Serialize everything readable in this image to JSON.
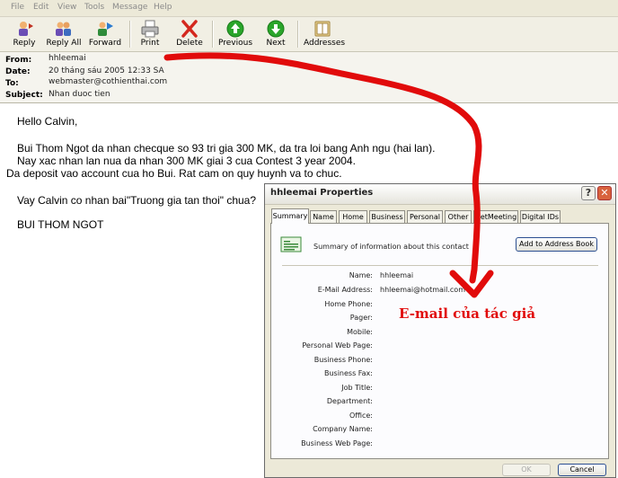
{
  "menu": [
    "File",
    "Edit",
    "View",
    "Tools",
    "Message",
    "Help"
  ],
  "toolbar": {
    "reply": "Reply",
    "reply_all": "Reply All",
    "forward": "Forward",
    "print": "Print",
    "delete": "Delete",
    "previous": "Previous",
    "next": "Next",
    "addresses": "Addresses"
  },
  "header": {
    "from_label": "From:",
    "from": "hhleemai",
    "date_label": "Date:",
    "date": "20 tháng sáu 2005 12:33 SA",
    "to_label": "To:",
    "to": "webmaster@cothienthai.com",
    "subject_label": "Subject:",
    "subject": "Nhan duoc tien"
  },
  "body": {
    "greeting": "Hello Calvin,",
    "line1": "Bui Thom Ngot da nhan checque so 93 tri gia 300 MK, da tra loi bang Anh ngu (hai lan).",
    "line2": "Nay xac nhan lan nua da nhan 300 MK giai 3 cua Contest 3 year 2004.",
    "line3": "Da deposit vao account cua ho Bui. Rat cam on quy huynh va to chuc.",
    "line4": "Vay Calvin co nhan bai\"Truong gia tan thoi\" chua?",
    "signature": "BUI THOM NGOT"
  },
  "dialog": {
    "title": "hhleemai Properties",
    "help": "?",
    "close": "✕",
    "tabs": [
      "Summary",
      "Name",
      "Home",
      "Business",
      "Personal",
      "Other",
      "NetMeeting",
      "Digital IDs"
    ],
    "active_tab": "Summary",
    "summary_text": "Summary of information about this contact",
    "add_button": "Add to Address Book",
    "fields": [
      {
        "label": "Name:",
        "value": "hhleemai"
      },
      {
        "label": "E-Mail Address:",
        "value": "hhleemai@hotmail.com"
      },
      {
        "label": "Home Phone:",
        "value": ""
      },
      {
        "label": "Pager:",
        "value": ""
      },
      {
        "label": "Mobile:",
        "value": ""
      },
      {
        "label": "Personal Web Page:",
        "value": ""
      },
      {
        "label": "Business Phone:",
        "value": ""
      },
      {
        "label": "Business Fax:",
        "value": ""
      },
      {
        "label": "Job Title:",
        "value": ""
      },
      {
        "label": "Department:",
        "value": ""
      },
      {
        "label": "Office:",
        "value": ""
      },
      {
        "label": "Company Name:",
        "value": ""
      },
      {
        "label": "Business Web Page:",
        "value": ""
      }
    ],
    "ok": "OK",
    "cancel": "Cancel"
  },
  "annotation": "E-mail của tác giả",
  "colors": {
    "annotation_red": "#e10b0b",
    "chrome": "#ece9d8",
    "toolbar_green": "#2aa52a",
    "delete_red": "#d4281e"
  },
  "icons": [
    "reply-icon",
    "reply-all-icon",
    "forward-icon",
    "print-icon",
    "delete-icon",
    "previous-icon",
    "next-icon",
    "addresses-icon",
    "contact-card-icon"
  ]
}
